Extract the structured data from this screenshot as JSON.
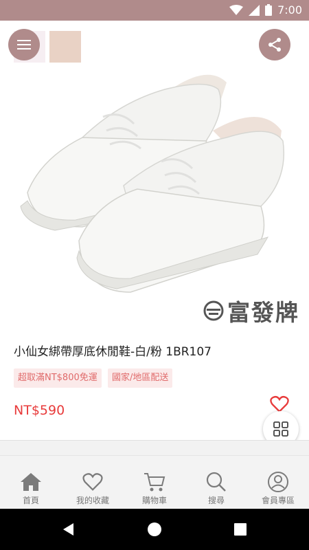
{
  "status_bar": {
    "time": "7:00",
    "icons": [
      "wifi-icon",
      "signal-icon",
      "battery-icon"
    ]
  },
  "header": {
    "menu_icon": "hamburger-icon",
    "share_icon": "share-icon"
  },
  "product": {
    "brand": "富發牌",
    "title": "小仙女綁帶厚底休閒鞋-白/粉  1BR107",
    "tags": [
      "超取滿NT$800免運",
      "國家/地區配送"
    ],
    "price": "NT$590"
  },
  "colors": {
    "accent": "#b08b8b",
    "price": "#e83b3b",
    "tag_bg": "#fbeaea",
    "tag_text": "#e06a6a"
  },
  "bottom_nav": [
    {
      "label": "首頁",
      "icon": "home-icon"
    },
    {
      "label": "我的收藏",
      "icon": "heart-icon"
    },
    {
      "label": "購物車",
      "icon": "cart-icon"
    },
    {
      "label": "搜尋",
      "icon": "search-icon"
    },
    {
      "label": "會員專區",
      "icon": "user-icon"
    }
  ]
}
